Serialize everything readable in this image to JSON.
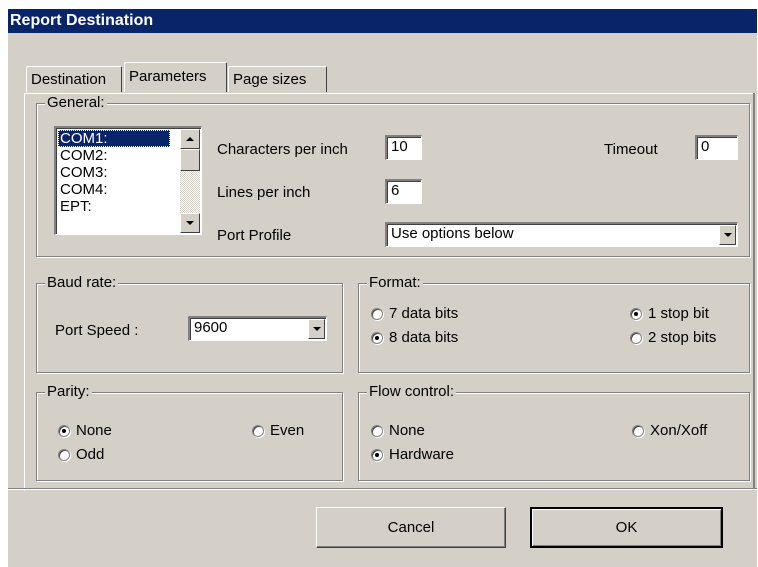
{
  "window": {
    "title": "Report Destination"
  },
  "tabs": [
    {
      "label": "Destination"
    },
    {
      "label": "Parameters"
    },
    {
      "label": "Page sizes"
    }
  ],
  "general": {
    "legend": "General:",
    "ports": [
      "COM1:",
      "COM2:",
      "COM3:",
      "COM4:",
      "EPT:"
    ],
    "selected_port": "COM1:",
    "cpi_label": "Characters per inch",
    "cpi_value": "10",
    "timeout_label": "Timeout",
    "timeout_value": "0",
    "lpi_label": "Lines per inch",
    "lpi_value": "6",
    "profile_label": "Port Profile",
    "profile_value": "Use options below"
  },
  "baud": {
    "legend": "Baud rate:",
    "speed_label": "Port Speed :",
    "speed_value": "9600"
  },
  "format": {
    "legend": "Format:",
    "bits7": "7 data bits",
    "bits8": "8 data bits",
    "stop1": "1 stop bit",
    "stop2": "2 stop bits",
    "selected_data_bits": "8 data bits",
    "selected_stop_bits": "1 stop bit"
  },
  "parity": {
    "legend": "Parity:",
    "none": "None",
    "even": "Even",
    "odd": "Odd",
    "selected": "None"
  },
  "flow": {
    "legend": "Flow control:",
    "none": "None",
    "xon": "Xon/Xoff",
    "hardware": "Hardware",
    "selected": "Hardware"
  },
  "buttons": {
    "cancel": "Cancel",
    "ok": "OK"
  },
  "colors": {
    "titlebar": "#0a246a",
    "face": "#d4d0c8",
    "selection": "#0a246a"
  }
}
